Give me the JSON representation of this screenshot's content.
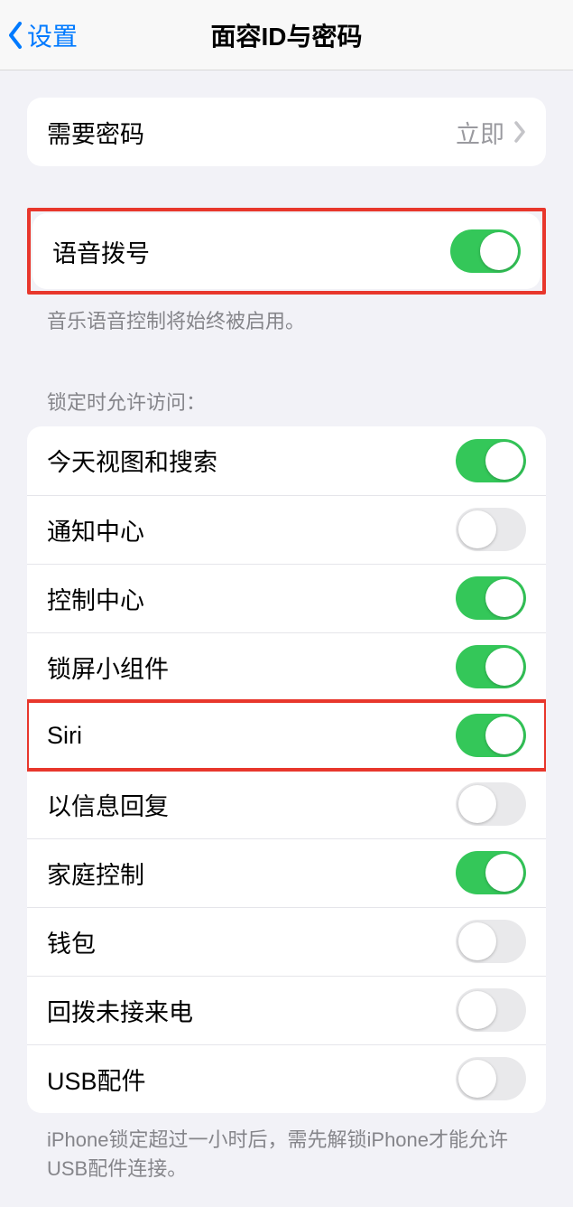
{
  "header": {
    "back_label": "设置",
    "title": "面容ID与密码"
  },
  "passcode_group": {
    "require_passcode": {
      "label": "需要密码",
      "value": "立即"
    }
  },
  "voice_dial_group": {
    "voice_dial": {
      "label": "语音拨号",
      "on": true
    },
    "footer": "音乐语音控制将始终被启用。"
  },
  "lock_access": {
    "header": "锁定时允许访问：",
    "items": [
      {
        "label": "今天视图和搜索",
        "on": true
      },
      {
        "label": "通知中心",
        "on": false
      },
      {
        "label": "控制中心",
        "on": true
      },
      {
        "label": "锁屏小组件",
        "on": true
      },
      {
        "label": "Siri",
        "on": true
      },
      {
        "label": "以信息回复",
        "on": false
      },
      {
        "label": "家庭控制",
        "on": true
      },
      {
        "label": "钱包",
        "on": false
      },
      {
        "label": "回拨未接来电",
        "on": false
      },
      {
        "label": "USB配件",
        "on": false
      }
    ],
    "footer": "iPhone锁定超过一小时后，需先解锁iPhone才能允许USB配件连接。"
  }
}
